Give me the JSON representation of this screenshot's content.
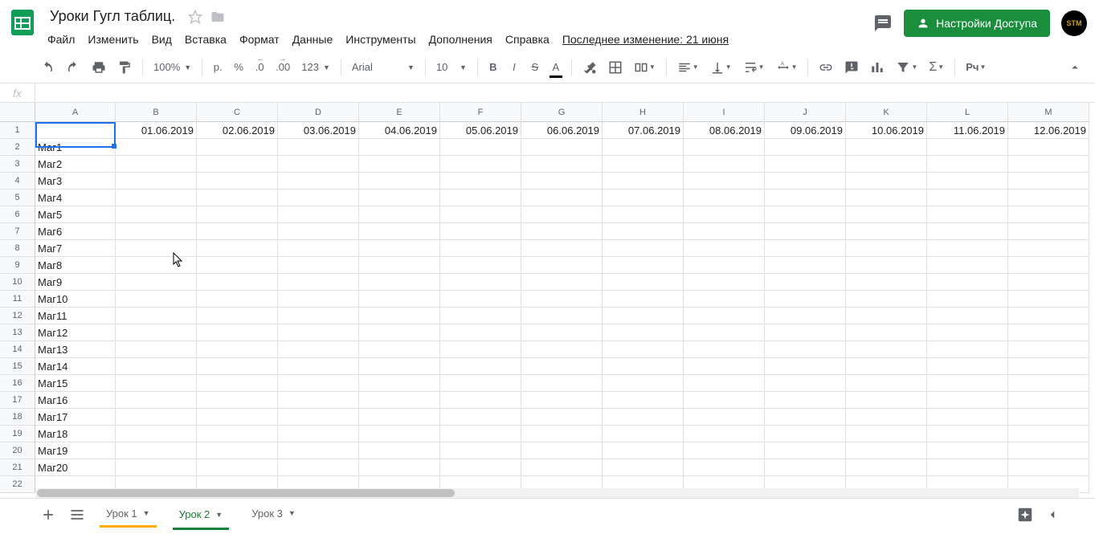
{
  "doc_title": "Уроки Гугл таблиц.",
  "menu": [
    "Файл",
    "Изменить",
    "Вид",
    "Вставка",
    "Формат",
    "Данные",
    "Инструменты",
    "Дополнения",
    "Справка"
  ],
  "last_edit": "Последнее изменение: 21 июня",
  "share_label": "Настройки Доступа",
  "avatar_text": "STM",
  "toolbar": {
    "zoom": "100%",
    "currency": "р.",
    "percent": "%",
    "dec_dec": ".0",
    "dec_inc": ".00",
    "numfmt": "123",
    "font": "Arial",
    "size": "10",
    "script": "Рч"
  },
  "fx_label": "fx",
  "fx_value": "",
  "columns": [
    "A",
    "B",
    "C",
    "D",
    "E",
    "F",
    "G",
    "H",
    "I",
    "J",
    "K",
    "L",
    "M"
  ],
  "row_headers": [
    "1",
    "2",
    "3",
    "4",
    "5",
    "6",
    "7",
    "8",
    "9",
    "10",
    "11",
    "12",
    "13",
    "14",
    "15",
    "16",
    "17",
    "18",
    "19",
    "20",
    "21",
    "22"
  ],
  "dates": [
    "",
    "01.06.2019",
    "02.06.2019",
    "03.06.2019",
    "04.06.2019",
    "05.06.2019",
    "06.06.2019",
    "07.06.2019",
    "08.06.2019",
    "09.06.2019",
    "10.06.2019",
    "11.06.2019",
    "12.06.2019"
  ],
  "colA": [
    "",
    "Маг1",
    "Маг2",
    "Маг3",
    "Маг4",
    "Маг5",
    "Маг6",
    "Маг7",
    "Маг8",
    "Маг9",
    "Маг10",
    "Маг11",
    "Маг12",
    "Маг13",
    "Маг14",
    "Маг15",
    "Маг16",
    "Маг17",
    "Маг18",
    "Маг19",
    "Маг20",
    ""
  ],
  "tabs": [
    {
      "label": "Урок 1"
    },
    {
      "label": "Урок 2"
    },
    {
      "label": "Урок 3"
    }
  ],
  "active_tab": 1
}
